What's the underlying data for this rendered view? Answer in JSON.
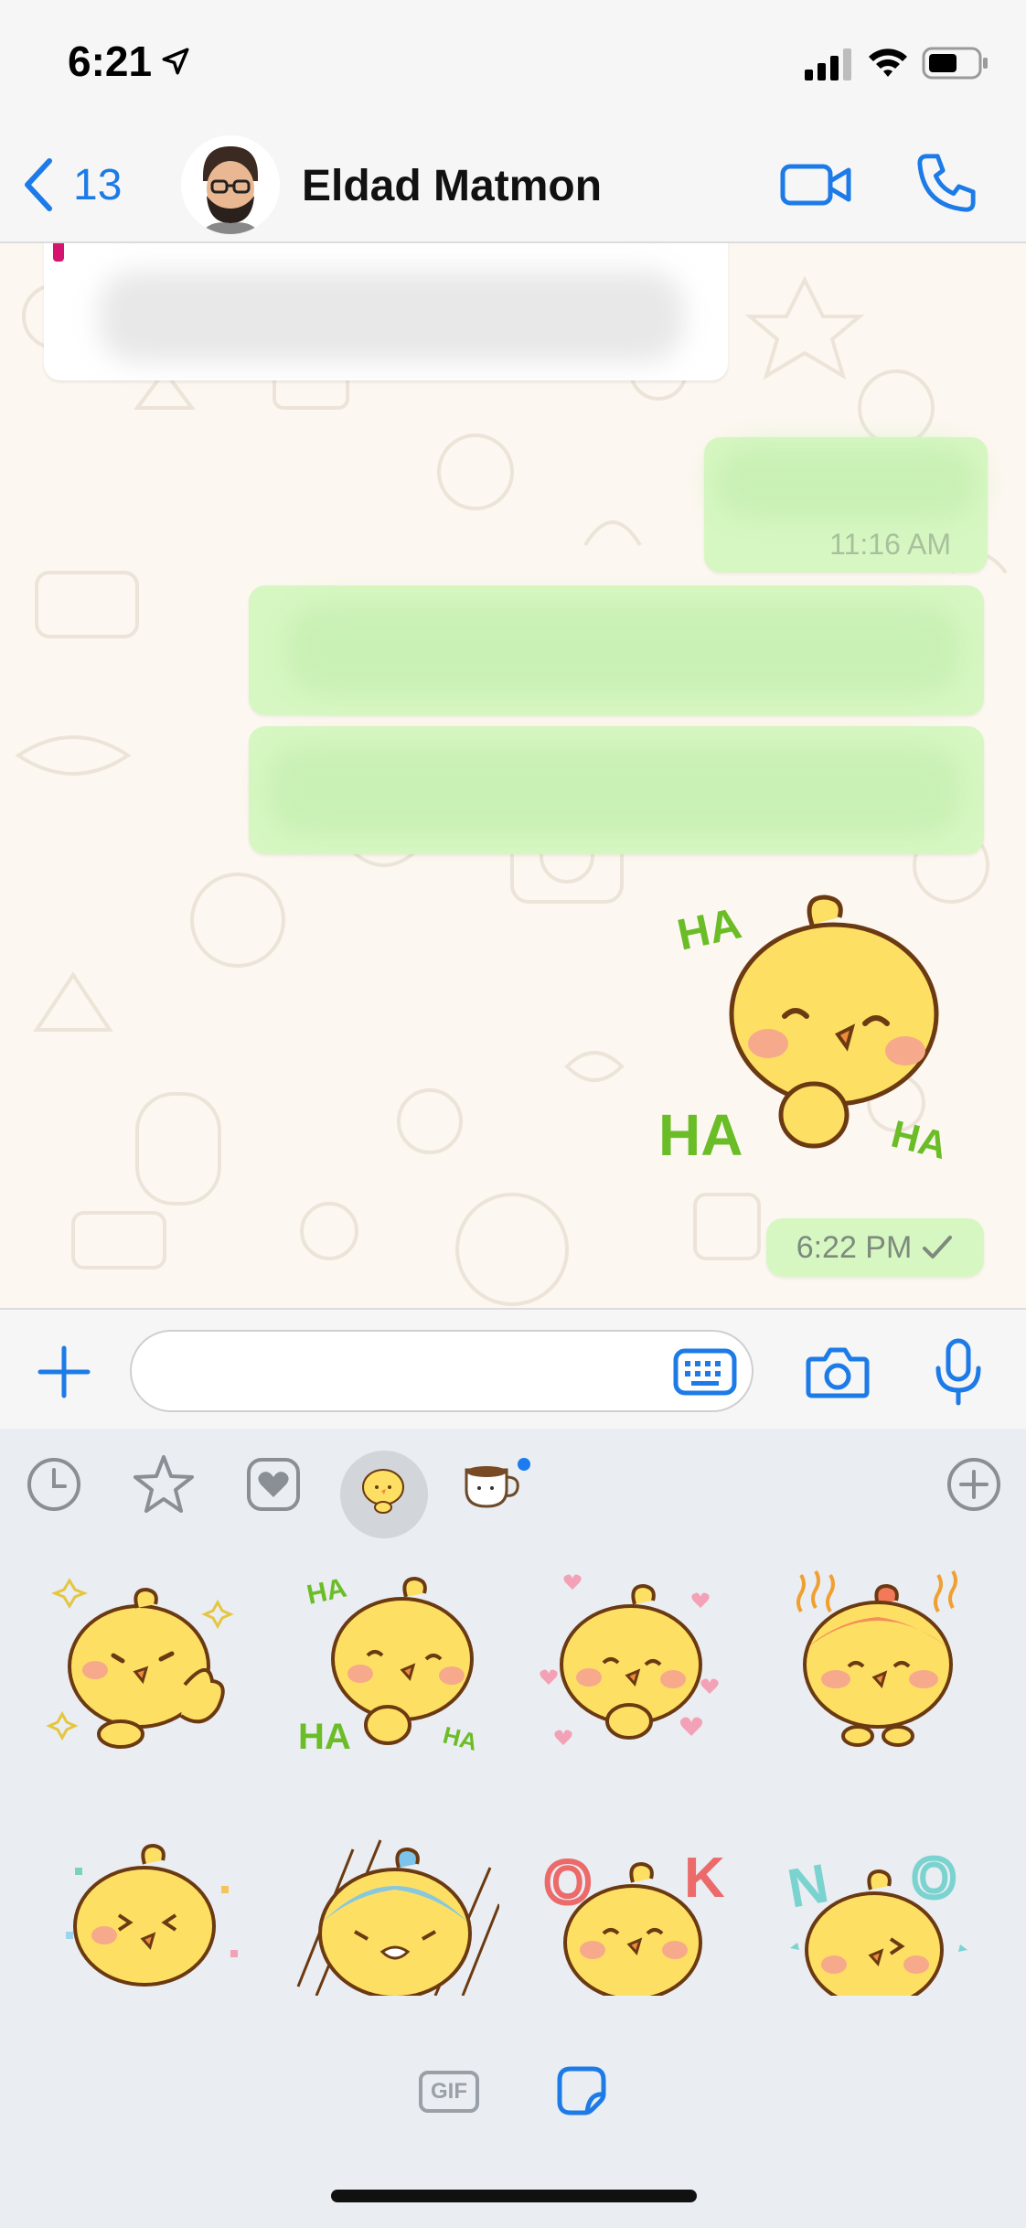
{
  "status_bar": {
    "time": "6:21",
    "icons": [
      "location-arrow-icon",
      "cellular-signal-icon",
      "wifi-icon",
      "battery-icon"
    ]
  },
  "header": {
    "back_count": "13",
    "contact_name": "Eldad Matmon",
    "icons": [
      "back-chevron-icon",
      "video-call-icon",
      "phone-call-icon"
    ]
  },
  "chat": {
    "blurred_time": "11:16 AM",
    "sticker_time": "6:22 PM",
    "sticker_text": {
      "top": "HA",
      "left": "HA",
      "right": "HA"
    }
  },
  "input_bar": {
    "value": "",
    "placeholder": ""
  },
  "sticker_panel": {
    "tray": [
      "recent-clock-icon",
      "favorites-star-icon",
      "heart-box-icon",
      "chick-sticker-pack",
      "coffee-sticker-pack",
      "add-pack-icon"
    ],
    "grid_text": {
      "ha_top": "HA",
      "ha_left": "HA",
      "ha_right": "HA",
      "o": "O",
      "k": "K",
      "n": "N",
      "o2": "O"
    },
    "gif_label": "GIF"
  },
  "colors": {
    "accent": "#1d7be8",
    "outgoing_bubble": "#d7f7c2",
    "chat_bg": "#fcf7f0",
    "chick_yellow": "#fde063"
  }
}
